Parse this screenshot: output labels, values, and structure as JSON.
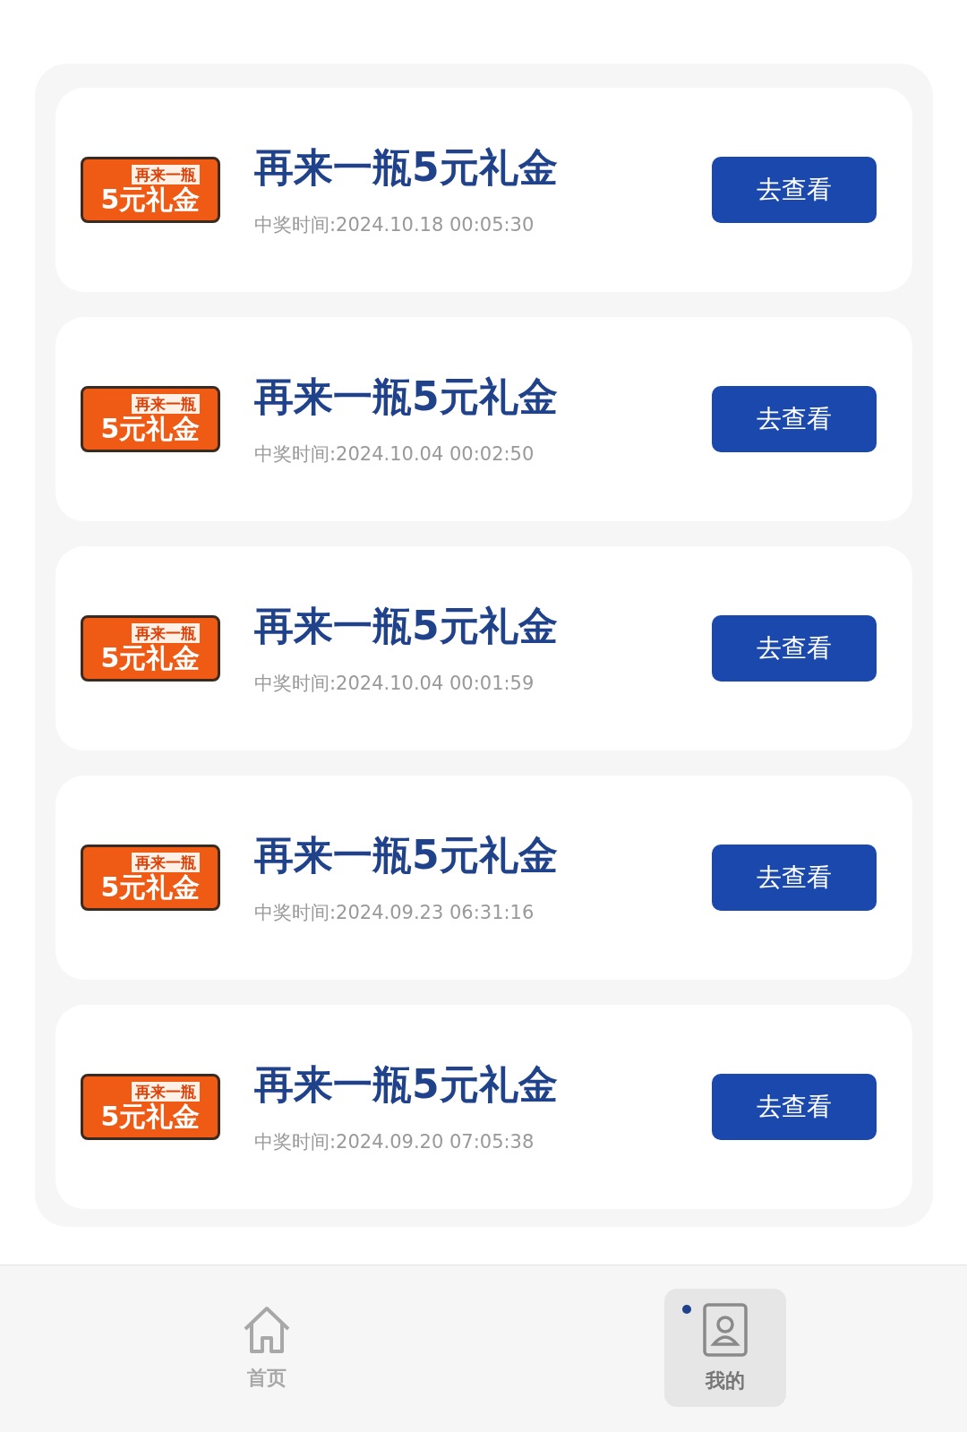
{
  "prizes": [
    {
      "badge_top": "再来一瓶",
      "badge_bottom": "5元礼金",
      "title": "再来一瓶5元礼金",
      "time": "中奖时间:2024.10.18 00:05:30",
      "button": "去查看"
    },
    {
      "badge_top": "再来一瓶",
      "badge_bottom": "5元礼金",
      "title": "再来一瓶5元礼金",
      "time": "中奖时间:2024.10.04 00:02:50",
      "button": "去查看"
    },
    {
      "badge_top": "再来一瓶",
      "badge_bottom": "5元礼金",
      "title": "再来一瓶5元礼金",
      "time": "中奖时间:2024.10.04 00:01:59",
      "button": "去查看"
    },
    {
      "badge_top": "再来一瓶",
      "badge_bottom": "5元礼金",
      "title": "再来一瓶5元礼金",
      "time": "中奖时间:2024.09.23 06:31:16",
      "button": "去查看"
    },
    {
      "badge_top": "再来一瓶",
      "badge_bottom": "5元礼金",
      "title": "再来一瓶5元礼金",
      "time": "中奖时间:2024.09.20 07:05:38",
      "button": "去查看"
    }
  ],
  "tab_bar": [
    {
      "kind": "home",
      "label": "首页",
      "selected": false
    },
    {
      "kind": "profile",
      "label": "我的",
      "selected": true
    }
  ]
}
